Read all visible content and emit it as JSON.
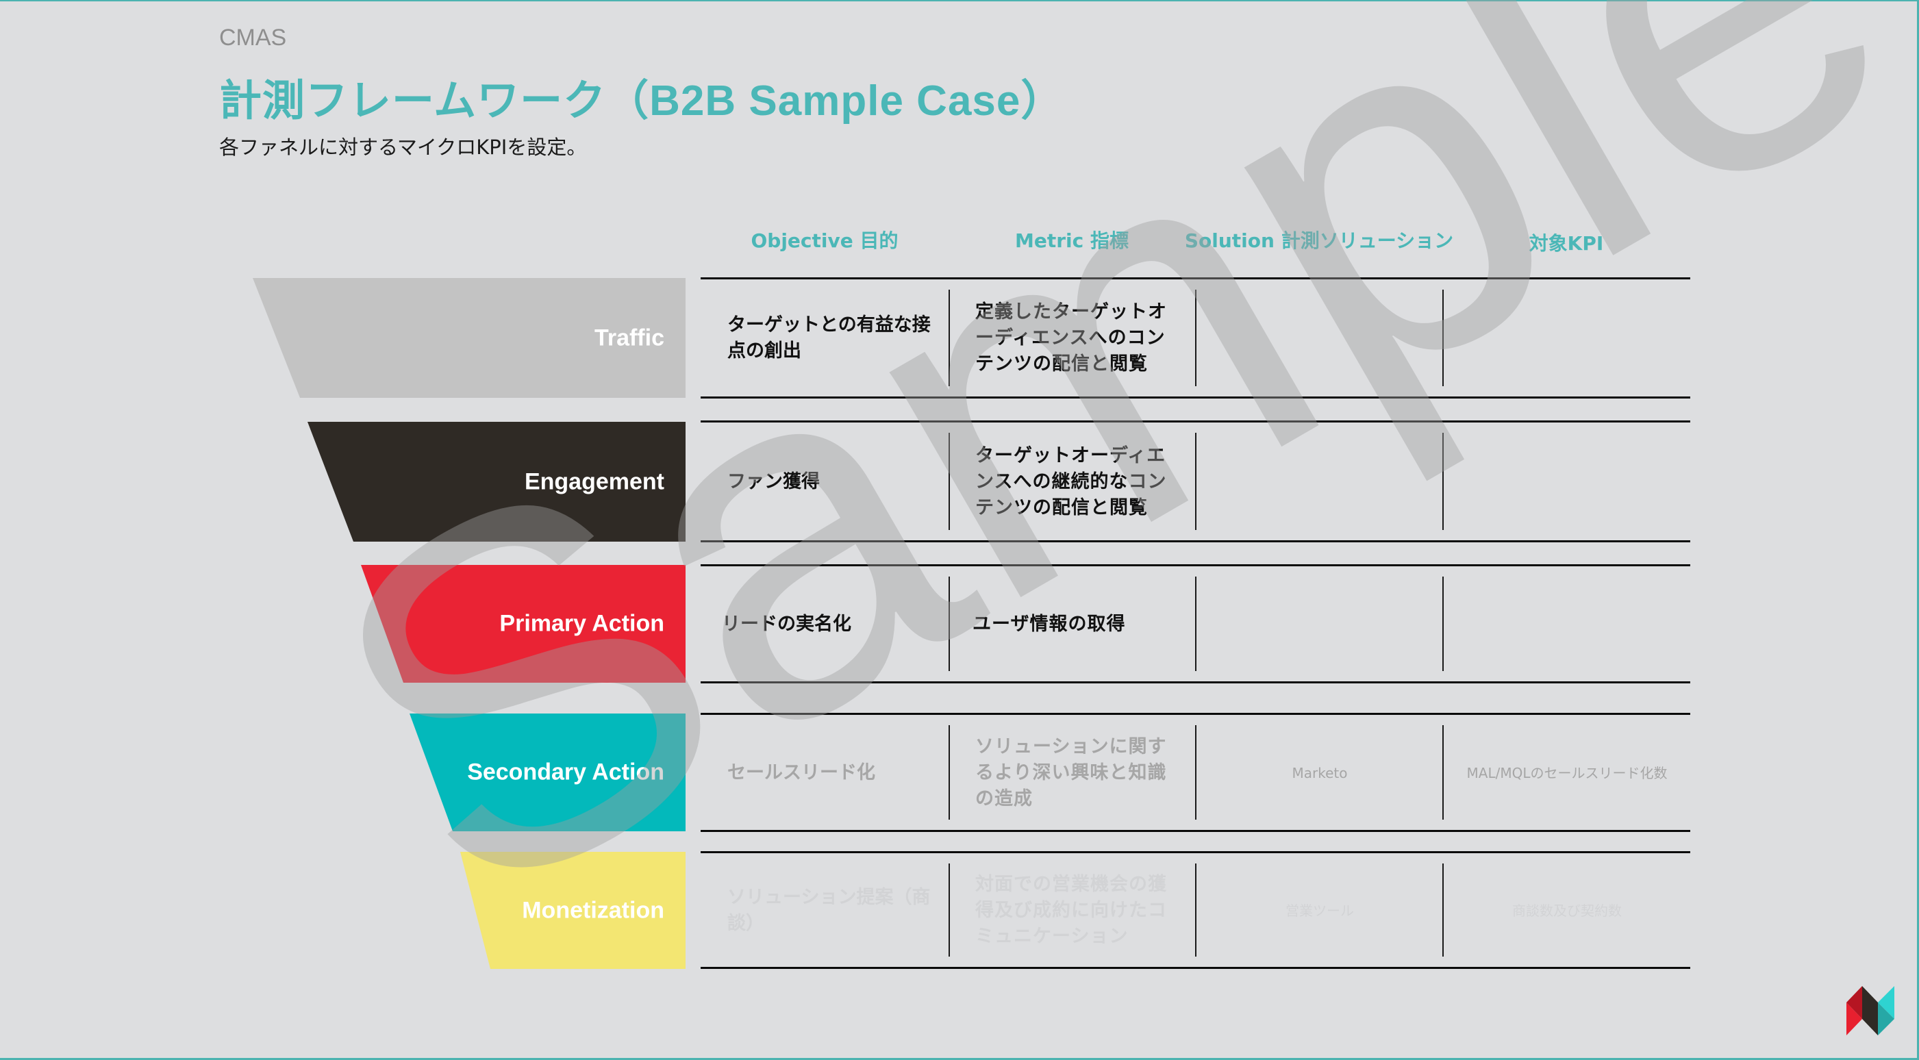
{
  "header": {
    "section": "CMAS",
    "title": "計測フレームワーク（B2B Sample Case）",
    "subtitle": "各ファネルに対するマイクロKPIを設定。"
  },
  "columns": [
    "Objective 目的",
    "Metric 指標",
    "Solution 計測ソリューション",
    "対象KPI"
  ],
  "stages": [
    {
      "name": "Traffic",
      "color": "#c3c3c3",
      "objective": "ターゲットとの有益な接点の創出",
      "metric": "定義したターゲットオーディエンスへのコンテンツの配信と閲覧",
      "solution": "",
      "kpi": "",
      "text_tone": "normal"
    },
    {
      "name": "Engagement",
      "color": "#2f2a25",
      "objective": "ファン獲得",
      "metric": "ターゲットオーディエンスへの継続的なコンテンツの配信と閲覧",
      "solution": "",
      "kpi": "",
      "text_tone": "normal"
    },
    {
      "name": "Primary Action",
      "color": "#ea2334",
      "objective": "リードの実名化",
      "metric": "ユーザ情報の取得",
      "solution": "",
      "kpi": "",
      "text_tone": "normal"
    },
    {
      "name": "Secondary Action",
      "color": "#03b9bb",
      "objective": "セールスリード化",
      "metric": "ソリューションに関するより深い興味と知識の造成",
      "solution": "Marketo",
      "kpi": "MAL/MQLのセールスリード化数",
      "text_tone": "muted"
    },
    {
      "name": "Monetization",
      "color": "#f3e672",
      "objective": "ソリューション提案（商談）",
      "metric": "対面での営業機会の獲得及び成約に向けたコミュニケーション",
      "solution": "営業ツール",
      "kpi": "商談数及び契約数",
      "text_tone": "faint"
    }
  ],
  "watermark": "Sample",
  "logo": {
    "name": "brand-logo",
    "colors": [
      "#e8202f",
      "#b51522",
      "#2f2a25",
      "#2ed3d1",
      "#26a8a6"
    ]
  }
}
